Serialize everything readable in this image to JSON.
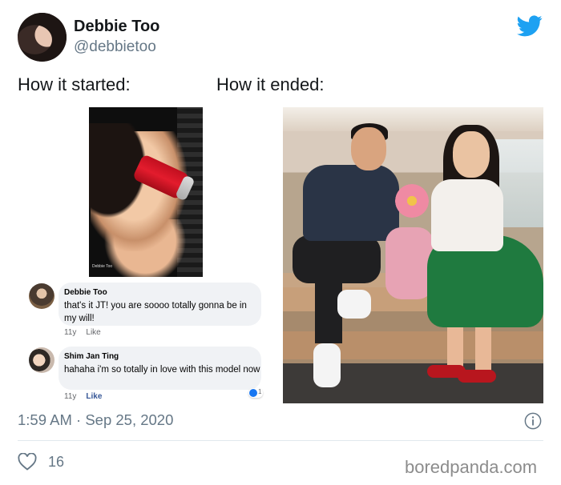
{
  "author": {
    "name": "Debbie Too",
    "handle": "@debbietoo"
  },
  "captions": {
    "left": "How it started:",
    "right": "How it ended:"
  },
  "left_photo": {
    "signature": "Debbie Too"
  },
  "comments": [
    {
      "name": "Debbie Too",
      "text": "that's it JT! you are soooo totally gonna be in my will!",
      "age": "11y",
      "like": "Like"
    },
    {
      "name": "Shim Jan Ting",
      "text": "hahaha i'm so totally in love with this model now",
      "age": "11y",
      "like": "Like",
      "reactions": "1"
    }
  ],
  "tweet": {
    "timestamp": "1:59 AM · Sep 25, 2020",
    "likes": "16"
  },
  "watermark": "boredpanda.com",
  "colors": {
    "twitter_blue": "#1da1f2",
    "meta_gray": "#657786"
  },
  "icons": [
    "twitter-logo-icon",
    "info-icon",
    "heart-icon",
    "like-reaction-icon"
  ]
}
